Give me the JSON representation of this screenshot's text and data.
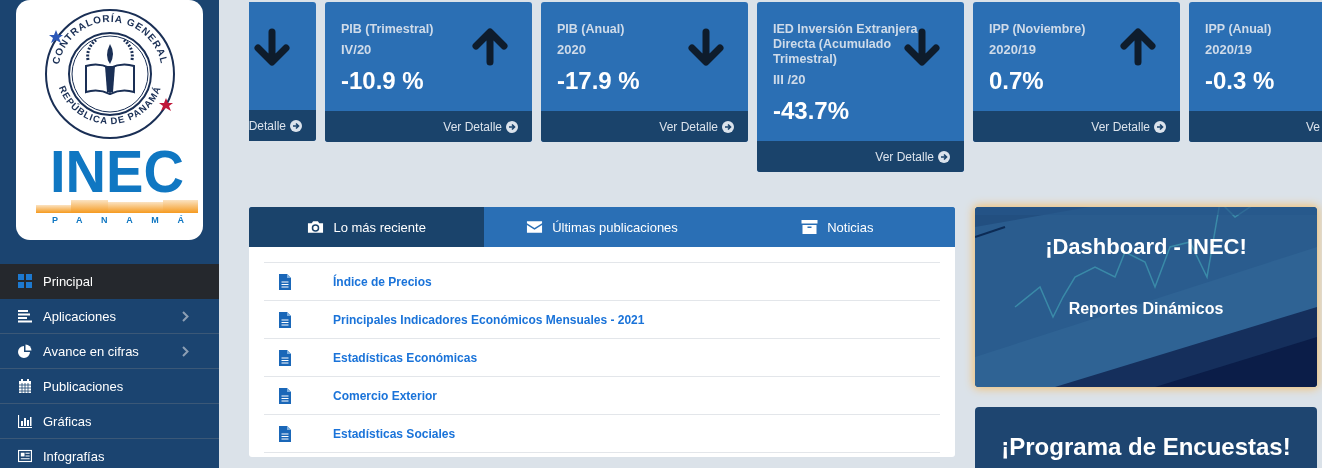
{
  "sidebar": {
    "logo": {
      "seal_top": "CONTRALORÍA GENERAL",
      "seal_bottom": "REPÚBLICA DE PANAMÁ",
      "brand": "INEC",
      "country": "PANAMÁ"
    },
    "menu": [
      {
        "label": "Principal",
        "selected": true,
        "has_submenu": false
      },
      {
        "label": "Aplicaciones",
        "selected": false,
        "has_submenu": true
      },
      {
        "label": "Avance en cifras",
        "selected": false,
        "has_submenu": true
      },
      {
        "label": "Publicaciones",
        "selected": false,
        "has_submenu": false
      },
      {
        "label": "Gráficas",
        "selected": false,
        "has_submenu": false
      },
      {
        "label": "Infografías",
        "selected": false,
        "has_submenu": false
      }
    ]
  },
  "indicators": [
    {
      "kind": "cut_left",
      "up": false,
      "link": "Detalle"
    },
    {
      "kind": "full",
      "title": "PIB (Trimestral)",
      "period": "IV/20",
      "value": "-10.9 %",
      "up": true,
      "link": "Ver Detalle"
    },
    {
      "kind": "full",
      "title": "PIB (Anual)",
      "period": "2020",
      "value": "-17.9 %",
      "up": false,
      "link": "Ver Detalle"
    },
    {
      "kind": "full",
      "title": "IED Inversión Extranjera Directa (Acumulado Trimestral)",
      "period": "III /20",
      "value": "-43.7%",
      "up": false,
      "link": "Ver Detalle"
    },
    {
      "kind": "full",
      "title": "IPP (Noviembre)",
      "period": "2020/19",
      "value": "0.7%",
      "up": true,
      "link": "Ver Detalle"
    },
    {
      "kind": "cut_right",
      "title": "IPP (Anual)",
      "period": "2020/19",
      "value": "-0.3 %",
      "link": "Ve"
    }
  ],
  "tabs": [
    {
      "label": "Lo más reciente",
      "selected": true
    },
    {
      "label": "Últimas publicaciones",
      "selected": false
    },
    {
      "label": "Noticias",
      "selected": false
    }
  ],
  "recent": [
    "Índice de Precios",
    "Principales Indicadores Económicos Mensuales - 2021",
    "Estadísticas Económicas",
    "Comercio Exterior",
    "Estadísticas Sociales"
  ],
  "promos": [
    {
      "title": "¡Dashboard - INEC!",
      "subtitle": "Reportes Dinámicos",
      "highlighted": true
    },
    {
      "title": "¡Programa de Encuestas!",
      "highlighted": false
    }
  ]
}
